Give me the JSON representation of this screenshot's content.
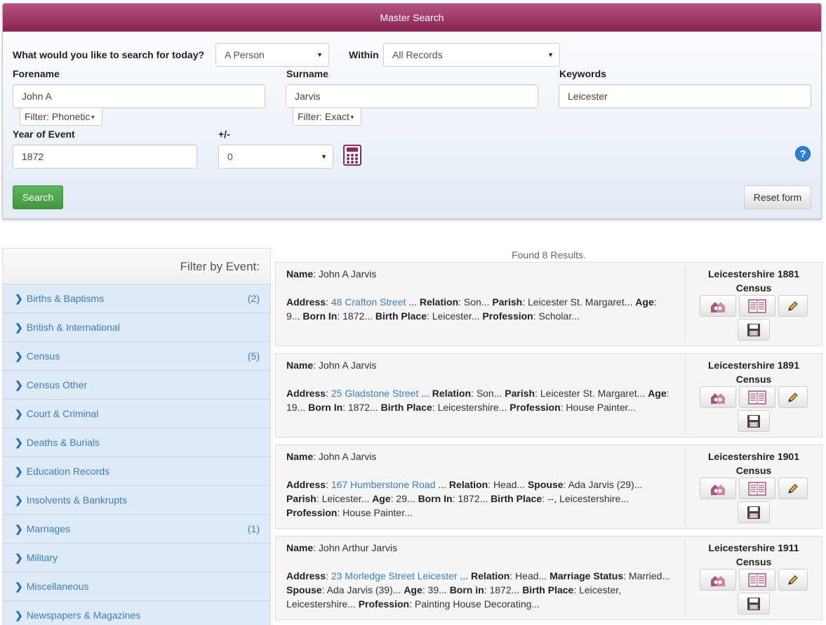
{
  "header": {
    "title": "Master Search"
  },
  "form": {
    "search_for_label": "What would you like to search for today?",
    "search_for_value": "A Person",
    "within_label": "Within",
    "within_value": "All Records",
    "forename_label": "Forename",
    "forename_value": "John A",
    "forename_filter": "Filter: Phonetic",
    "surname_label": "Surname",
    "surname_value": "Jarvis",
    "surname_filter": "Filter: Exact",
    "keywords_label": "Keywords",
    "keywords_value": "Leicester",
    "year_label": "Year of Event",
    "year_value": "1872",
    "range_label": "+/-",
    "range_value": "0",
    "search_button": "Search",
    "reset_button": "Reset form",
    "help_icon": "?"
  },
  "filter_panel": {
    "title": "Filter by Event:",
    "items": [
      {
        "label": "Births & Baptisms",
        "count": "(2)"
      },
      {
        "label": "British & International",
        "count": ""
      },
      {
        "label": "Census",
        "count": "(5)"
      },
      {
        "label": "Census Other",
        "count": ""
      },
      {
        "label": "Court & Criminal",
        "count": ""
      },
      {
        "label": "Deaths & Burials",
        "count": ""
      },
      {
        "label": "Education Records",
        "count": ""
      },
      {
        "label": "Insolvents & Bankrupts",
        "count": ""
      },
      {
        "label": "Marriages",
        "count": "(1)"
      },
      {
        "label": "Military",
        "count": ""
      },
      {
        "label": "Miscellaneous",
        "count": ""
      },
      {
        "label": "Newspapers & Magazines",
        "count": ""
      }
    ]
  },
  "results": {
    "found_text": "Found 8 Results.",
    "items": [
      {
        "name_label": "Name",
        "name": "John A Jarvis",
        "address_label": "Address",
        "address": "48 Crafton Street",
        "side_title": "Leicestershire 1881",
        "side_sub": "Census",
        "fields": [
          {
            "k": "Relation",
            "v": "Son..."
          },
          {
            "k": "Parish",
            "v": "Leicester St. Margaret..."
          },
          {
            "k": "Age",
            "v": "9..."
          },
          {
            "k": "Born In",
            "v": "1872..."
          },
          {
            "k": "Birth Place",
            "v": "Leicester..."
          },
          {
            "k": "Profession",
            "v": "Scholar..."
          }
        ]
      },
      {
        "name_label": "Name",
        "name": "John A Jarvis",
        "address_label": "Address",
        "address": "25 Gladstone Street",
        "side_title": "Leicestershire 1891",
        "side_sub": "Census",
        "fields": [
          {
            "k": "Relation",
            "v": "Son..."
          },
          {
            "k": "Parish",
            "v": "Leicester St. Margaret..."
          },
          {
            "k": "Age",
            "v": "19..."
          },
          {
            "k": "Born In",
            "v": "1872..."
          },
          {
            "k": "Birth Place",
            "v": "Leicestershire..."
          },
          {
            "k": "Profession",
            "v": "House Painter..."
          }
        ]
      },
      {
        "name_label": "Name",
        "name": "John A Jarvis",
        "address_label": "Address",
        "address": "167 Humberstone Road",
        "side_title": "Leicestershire 1901",
        "side_sub": "Census",
        "fields": [
          {
            "k": "Relation",
            "v": "Head..."
          },
          {
            "k": "Spouse",
            "v": "Ada Jarvis (29)..."
          },
          {
            "k": "Parish",
            "v": "Leicester..."
          },
          {
            "k": "Age",
            "v": "29..."
          },
          {
            "k": "Born In",
            "v": "1872..."
          },
          {
            "k": "Birth Place",
            "v": "--, Leicestershire..."
          },
          {
            "k": "Profession",
            "v": "House Painter..."
          }
        ]
      },
      {
        "name_label": "Name",
        "name": "John Arthur Jarvis",
        "address_label": "Address",
        "address": "23 Morledge Street Leicester",
        "side_title": "Leicestershire 1911",
        "side_sub": "Census",
        "fields": [
          {
            "k": "Relation",
            "v": "Head..."
          },
          {
            "k": "Marriage Status",
            "v": "Married..."
          },
          {
            "k": "Spouse",
            "v": "Ada Jarvis (39)..."
          },
          {
            "k": "Age",
            "v": "39..."
          },
          {
            "k": "Born in",
            "v": "1872..."
          },
          {
            "k": "Birth Place",
            "v": "Leicester, Leicestershire..."
          },
          {
            "k": "Profession",
            "v": "Painting House Decorating..."
          }
        ]
      }
    ]
  }
}
